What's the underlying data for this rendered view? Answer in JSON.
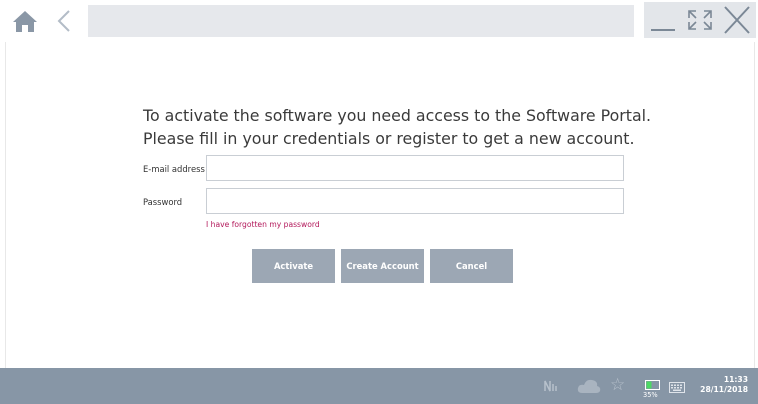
{
  "toolbar": {
    "home_icon": "home-icon",
    "back_icon": "back-arrow-icon",
    "address_bar_text": "",
    "minimize_icon": "minimize-icon",
    "maximize_icon": "maximize-icon",
    "close_icon": "close-icon"
  },
  "main": {
    "heading_line1": "To activate the software you need access to the Software Portal.",
    "heading_line2": "Please fill in your credentials or register to get a new account.",
    "email_label": "E-mail address",
    "email_value": "",
    "password_label": "Password",
    "password_value": "",
    "forgot_link": "I have forgotten my password",
    "buttons": {
      "activate": "Activate",
      "create_account": "Create Account",
      "cancel": "Cancel"
    }
  },
  "taskbar": {
    "battery_percent": "35%",
    "time": "11:33",
    "date": "28/11/2018",
    "icons": [
      "network-icon",
      "cloud-icon",
      "star-icon",
      "battery-icon",
      "keyboard-icon"
    ]
  },
  "colors": {
    "button_bg": "#9ca7b4",
    "link": "#b3195b",
    "taskbar_bg": "#8796a6",
    "toolbar_buttons": "#e3e6ea"
  }
}
